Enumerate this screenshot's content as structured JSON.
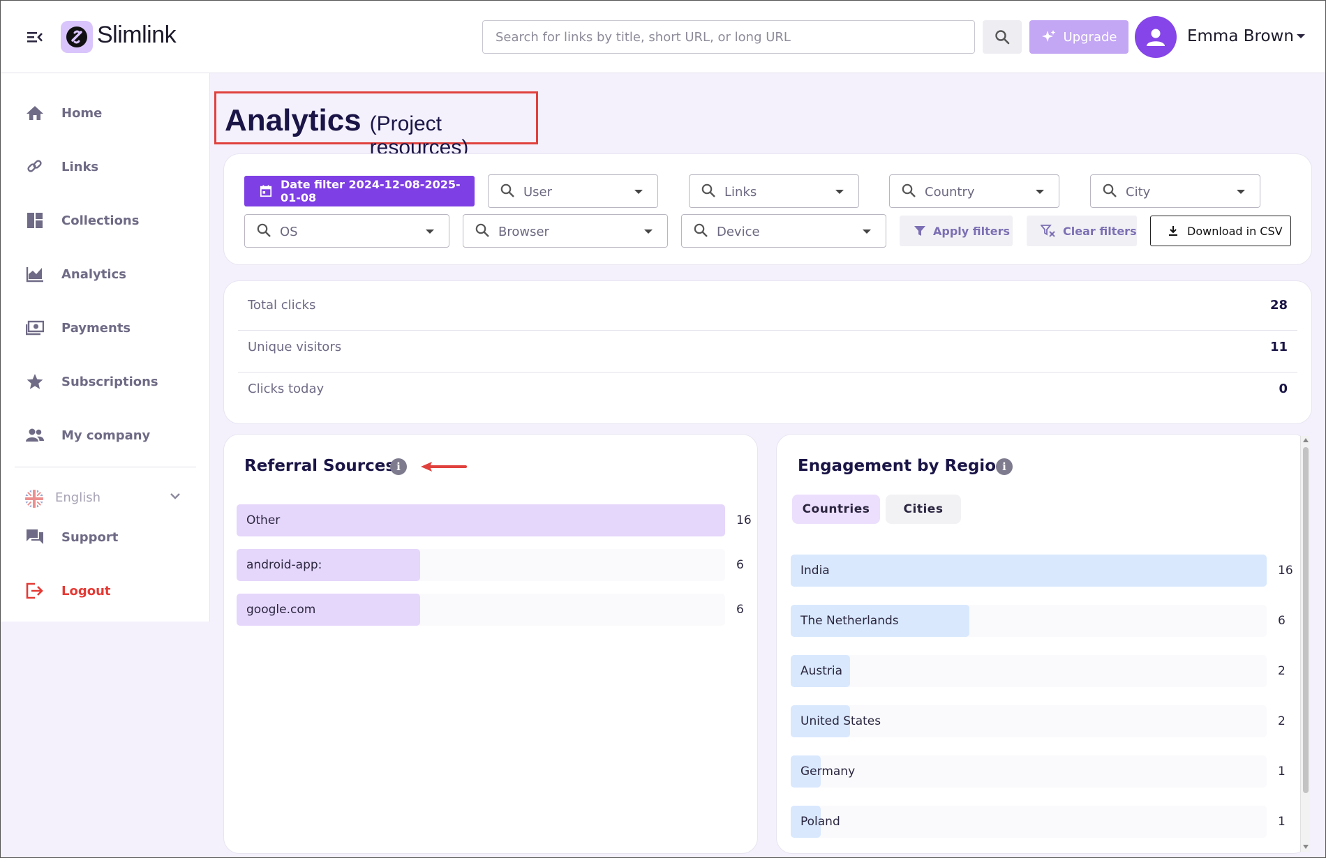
{
  "header": {
    "brand": "Slimlink",
    "search_placeholder": "Search for links by title, short URL, or long URL",
    "upgrade_label": "Upgrade",
    "user_name": "Emma Brown",
    "brand_color": "#7e3fe4"
  },
  "sidebar": {
    "items": [
      {
        "label": "Home",
        "icon": "home-icon"
      },
      {
        "label": "Links",
        "icon": "link-icon"
      },
      {
        "label": "Collections",
        "icon": "collections-icon"
      },
      {
        "label": "Analytics",
        "icon": "analytics-icon"
      },
      {
        "label": "Payments",
        "icon": "payments-icon"
      },
      {
        "label": "Subscriptions",
        "icon": "star-icon"
      },
      {
        "label": "My company",
        "icon": "people-icon"
      }
    ],
    "language": "English",
    "support_label": "Support",
    "logout_label": "Logout"
  },
  "page": {
    "title": "Analytics",
    "subtitle": "(Project resources)"
  },
  "filters": {
    "date_label": "Date filter 2024-12-08-2025-01-08",
    "selects": [
      "User",
      "Links",
      "Country",
      "City",
      "OS",
      "Browser",
      "Device"
    ],
    "apply_label": "Apply filters",
    "clear_label": "Clear filters",
    "csv_label": "Download in CSV"
  },
  "stats": [
    {
      "label": "Total clicks",
      "value": "28"
    },
    {
      "label": "Unique visitors",
      "value": "11"
    },
    {
      "label": "Clicks today",
      "value": "0"
    }
  ],
  "referral": {
    "title": "Referral Sources",
    "bar_color": "#e5d6fb",
    "max": 16,
    "rows": [
      {
        "label": "Other",
        "value": 16
      },
      {
        "label": "android-app:",
        "value": 6
      },
      {
        "label": "google.com",
        "value": 6
      }
    ]
  },
  "region": {
    "title": "Engagement by Region",
    "tabs": [
      "Countries",
      "Cities"
    ],
    "active_tab": "Countries",
    "bar_color": "#d9e8fd",
    "max": 16,
    "rows": [
      {
        "label": "India",
        "value": 16
      },
      {
        "label": "The Netherlands",
        "value": 6
      },
      {
        "label": "Austria",
        "value": 2
      },
      {
        "label": "United States",
        "value": 2
      },
      {
        "label": "Germany",
        "value": 1
      },
      {
        "label": "Poland",
        "value": 1
      }
    ]
  }
}
